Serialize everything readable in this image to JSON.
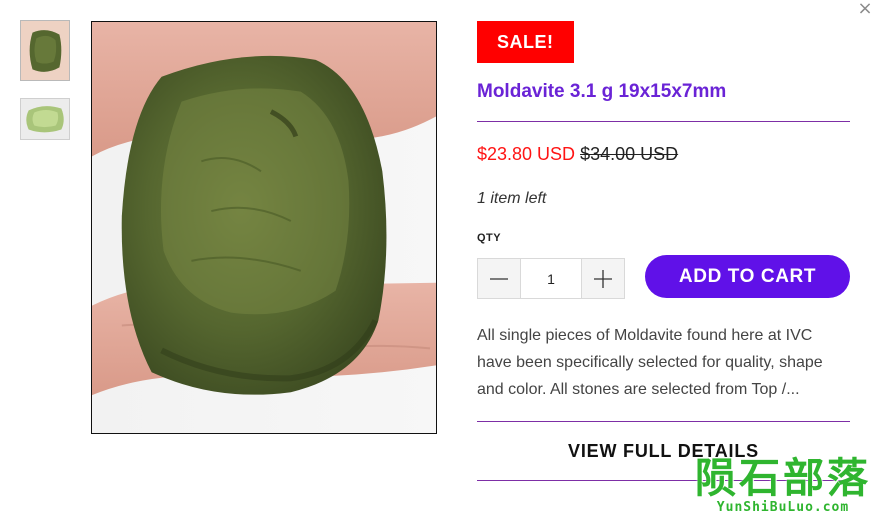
{
  "modal": {
    "close_symbol": "×"
  },
  "gallery": {
    "thumbnails": [
      {
        "icon": "moldavite-thumbnail-dark"
      },
      {
        "icon": "moldavite-thumbnail-light"
      }
    ],
    "main_image": {
      "icon": "moldavite-photo"
    }
  },
  "product": {
    "badge": "SALE!",
    "title": "Moldavite 3.1 g 19x15x7mm",
    "price": {
      "sale": "$23.80 USD",
      "compare_at": "$34.00 USD"
    },
    "stock_note": "1 item left",
    "qty_label": "QTY",
    "qty_value": "1",
    "add_to_cart_label": "ADD TO CART",
    "description": "All single pieces of Moldavite found here at IVC have been specifically selected for quality, shape and color. All stones are selected from Top /...",
    "view_details_label": "VIEW FULL DETAILS"
  },
  "watermark": {
    "chinese": "陨石部落",
    "latin": "YunShiBuLuo.com"
  },
  "colors": {
    "badge_bg": "#ff0000",
    "title": "#6a23d6",
    "sale_price": "#ff1414",
    "accent_button": "#6011e8",
    "divider": "#7d2ea6",
    "watermark": "#2fb52f"
  }
}
